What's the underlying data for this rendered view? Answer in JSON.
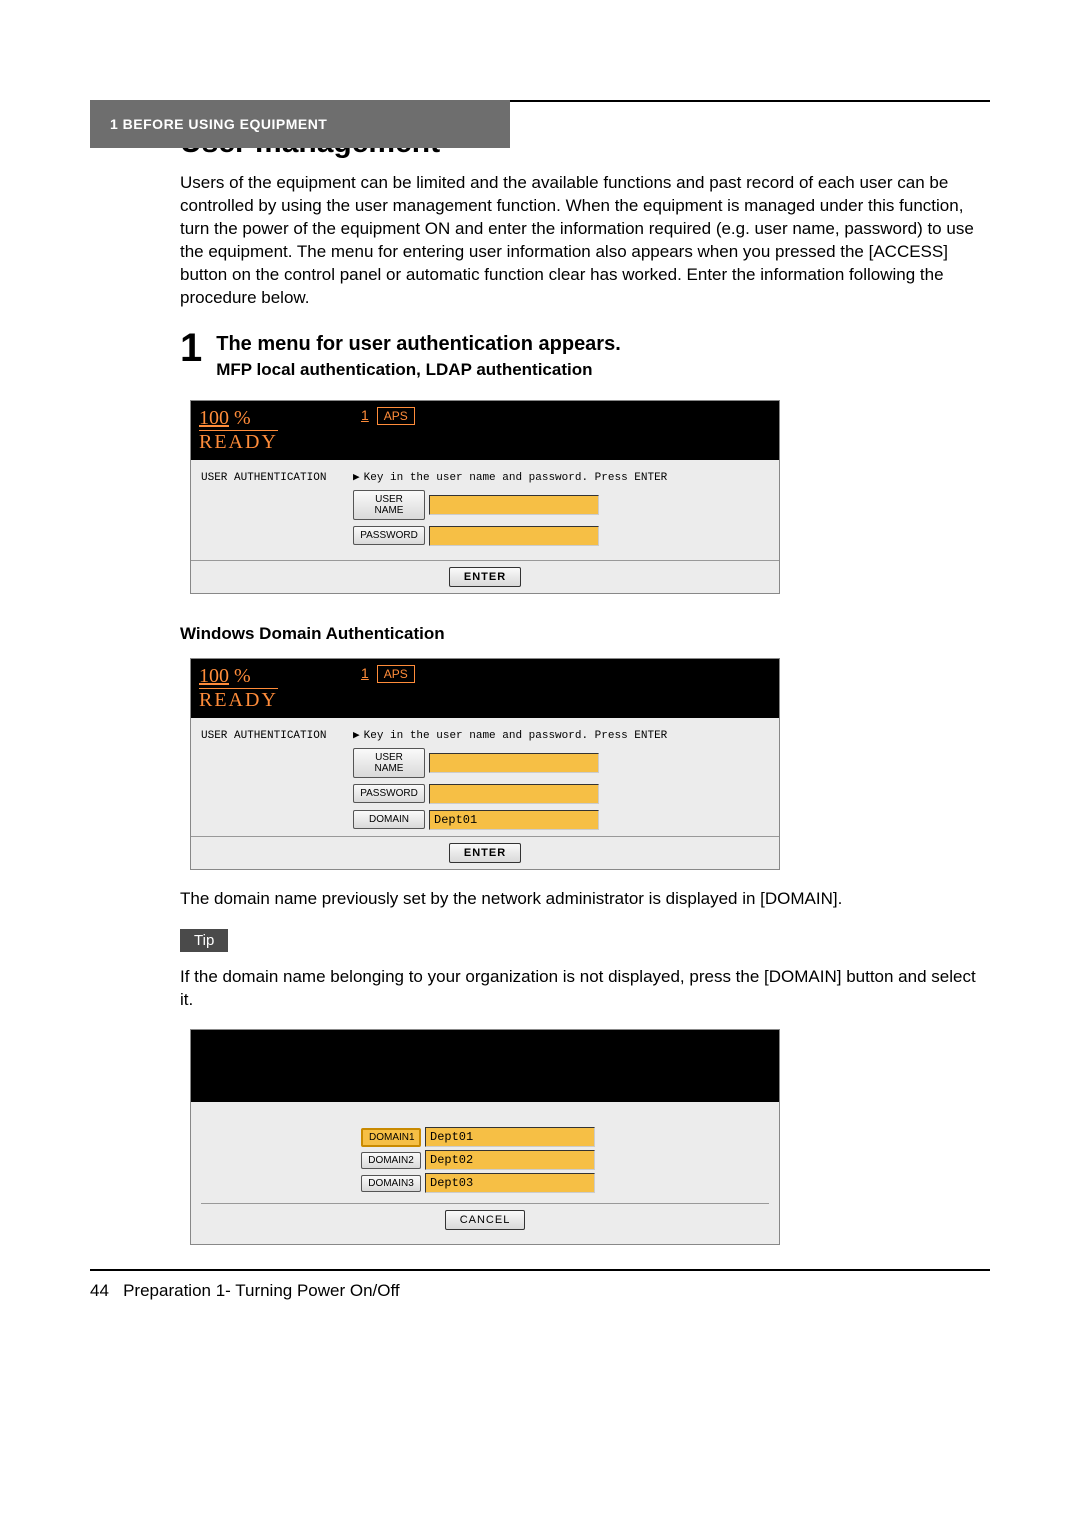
{
  "header": {
    "chapter": "1  BEFORE USING EQUIPMENT"
  },
  "title": "User management",
  "intro": "Users of the equipment can be limited and the available functions and past record of each user can be controlled by using the user management function. When the equipment is managed under this function, turn the power of the equipment ON and enter the information required (e.g. user name, password) to use the equipment. The menu for entering user information also appears when you pressed the [ACCESS] button on the control panel or automatic function clear has worked. Enter the information following the procedure below.",
  "step": {
    "number": "1",
    "title": "The menu for user authentication appears.",
    "subtitle1": "MFP local authentication, LDAP authentication",
    "subtitle2": "Windows Domain Authentication"
  },
  "screen_common": {
    "ready_value": "100",
    "ready_percent": "%",
    "ready_label": "READY",
    "aps_num": "1",
    "aps_label": "APS",
    "auth_title": "USER AUTHENTICATION",
    "hint": "Key in the user name and password. Press ENTER",
    "username_btn": "USER NAME",
    "password_btn": "PASSWORD",
    "domain_btn": "DOMAIN",
    "enter_btn": "ENTER"
  },
  "screen2": {
    "domain_value": "Dept01"
  },
  "domain_note": "The domain name previously set by the network administrator is displayed in [DOMAIN].",
  "tip": {
    "label": "Tip",
    "text": "If the domain name belonging to your organization is not displayed, press the [DOMAIN] button and select it."
  },
  "domain_select": {
    "rows": [
      {
        "btn": "DOMAIN1",
        "val": "Dept01",
        "selected": true
      },
      {
        "btn": "DOMAIN2",
        "val": "Dept02",
        "selected": false
      },
      {
        "btn": "DOMAIN3",
        "val": "Dept03",
        "selected": false
      }
    ],
    "cancel": "CANCEL"
  },
  "footer": {
    "page": "44",
    "text": "Preparation 1- Turning Power On/Off"
  }
}
